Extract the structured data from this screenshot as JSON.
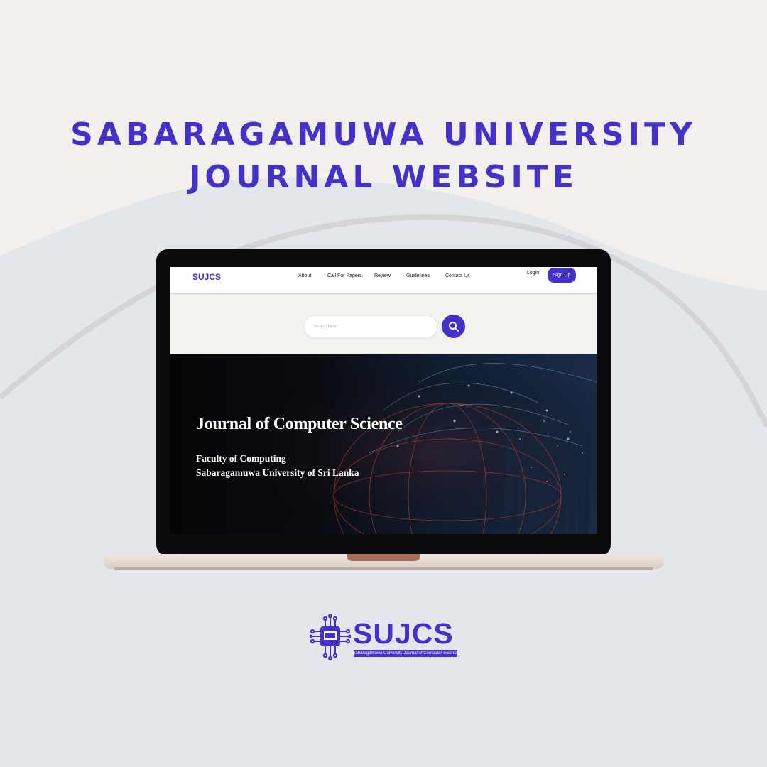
{
  "headline": {
    "line1": "SABARAGAMUWA UNIVERSITY",
    "line2": "JOURNAL WEBSITE"
  },
  "site": {
    "logo": "SUJCS",
    "nav": [
      "About",
      "Call For Papers",
      "Review",
      "Guidelines",
      "Contact Us"
    ],
    "login_label": "Login",
    "signup_label": "Sign Up",
    "search": {
      "placeholder": "Search here",
      "icon": "search-icon"
    },
    "hero": {
      "title": "Journal of Computer Science",
      "subtitle_line1": "Faculty of Computing",
      "subtitle_line2": "Sabaragamuwa University of Sri Lanka"
    }
  },
  "brand": {
    "name": "SUJCS",
    "tagline": "Sabaragamuwa University Journal of Computer Science",
    "icon": "circuit-chip-icon"
  },
  "colors": {
    "accent": "#4431c9",
    "background": "#f2efec",
    "background_shape": "#e3e6ea",
    "laptop_bezel": "#0b0b0d",
    "laptop_base": "#e7ddd6",
    "laptop_notch": "#a86c5c"
  }
}
